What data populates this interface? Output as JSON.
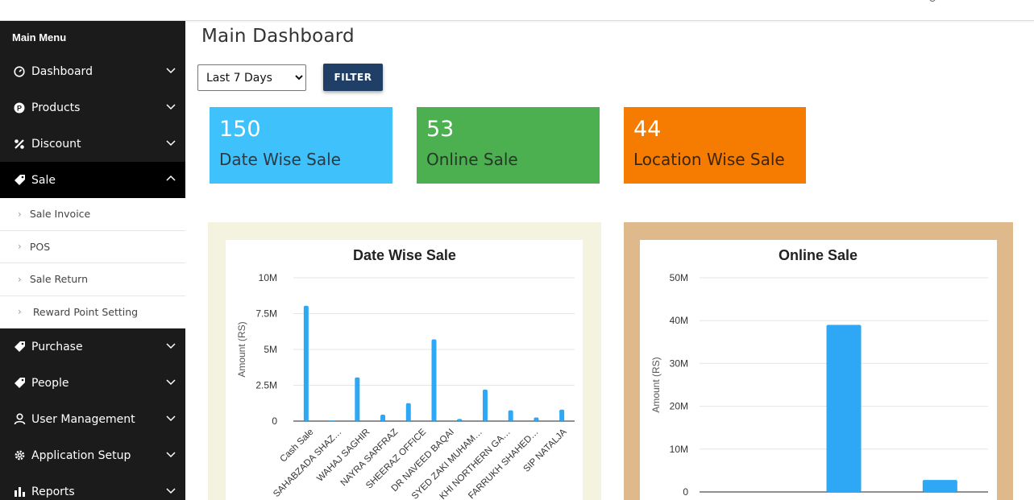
{
  "sidebar": {
    "heading": "Main Menu",
    "items": [
      {
        "label": "Dashboard",
        "icon": "gauge-icon"
      },
      {
        "label": "Products",
        "icon": "product-badge-icon"
      },
      {
        "label": "Discount",
        "icon": "percent-icon"
      },
      {
        "label": "Sale",
        "icon": "tag-icon",
        "expanded": true
      },
      {
        "label": "Purchase",
        "icon": "tag-icon"
      },
      {
        "label": "People",
        "icon": "tag-icon"
      },
      {
        "label": "User Management",
        "icon": "user-icon"
      },
      {
        "label": "Application Setup",
        "icon": "gear-icon"
      },
      {
        "label": "Reports",
        "icon": "bar-chart-icon"
      }
    ],
    "sale_submenu": [
      "Sale Invoice",
      "POS",
      "Sale Return",
      "Reward Point Setting"
    ]
  },
  "main": {
    "title": "Main Dashboard",
    "period": {
      "selected": "Last 7 Days"
    },
    "filter_label": "FILTER",
    "stats": [
      {
        "value": "150",
        "label": "Date Wise Sale",
        "color": "#3fc1fb"
      },
      {
        "value": "53",
        "label": "Online Sale",
        "color": "#4caf50"
      },
      {
        "value": "44",
        "label": "Location Wise Sale",
        "color": "#f57c00"
      }
    ]
  },
  "chart_data": [
    {
      "type": "bar",
      "title": "Date Wise Sale",
      "ylabel": "Amount (RS)",
      "xlabel": "",
      "yticks": [
        "0",
        "2.5M",
        "5M",
        "7.5M",
        "10M"
      ],
      "ylim": [
        0,
        10000000
      ],
      "categories": [
        "Cash Sale",
        "SAHABZADA SHAZ…",
        "WAHAJ SAGHIR",
        "NAYRA SARFRAZ",
        "SHEERAZ OFFICE",
        "DR NAVEED BAQAI",
        "SYED ZAKI MUHAM…",
        "KHI NORTHERN GA…",
        "FARRUKH SHAHED…",
        "SIP NATALJA"
      ],
      "values": [
        8050000,
        50000,
        3050000,
        450000,
        1250000,
        5700000,
        150000,
        2200000,
        750000,
        250000,
        800000
      ],
      "bar_color": "#2ea8f5",
      "grid": true
    },
    {
      "type": "bar",
      "title": "Online Sale",
      "ylabel": "Amount (RS)",
      "xlabel": "",
      "yticks": [
        "0",
        "10M",
        "20M",
        "30M",
        "40M",
        "50M"
      ],
      "ylim": [
        0,
        50000000
      ],
      "values": [
        0,
        39000000,
        2800000
      ],
      "bar_color": "#2ea8f5",
      "grid": true
    }
  ]
}
